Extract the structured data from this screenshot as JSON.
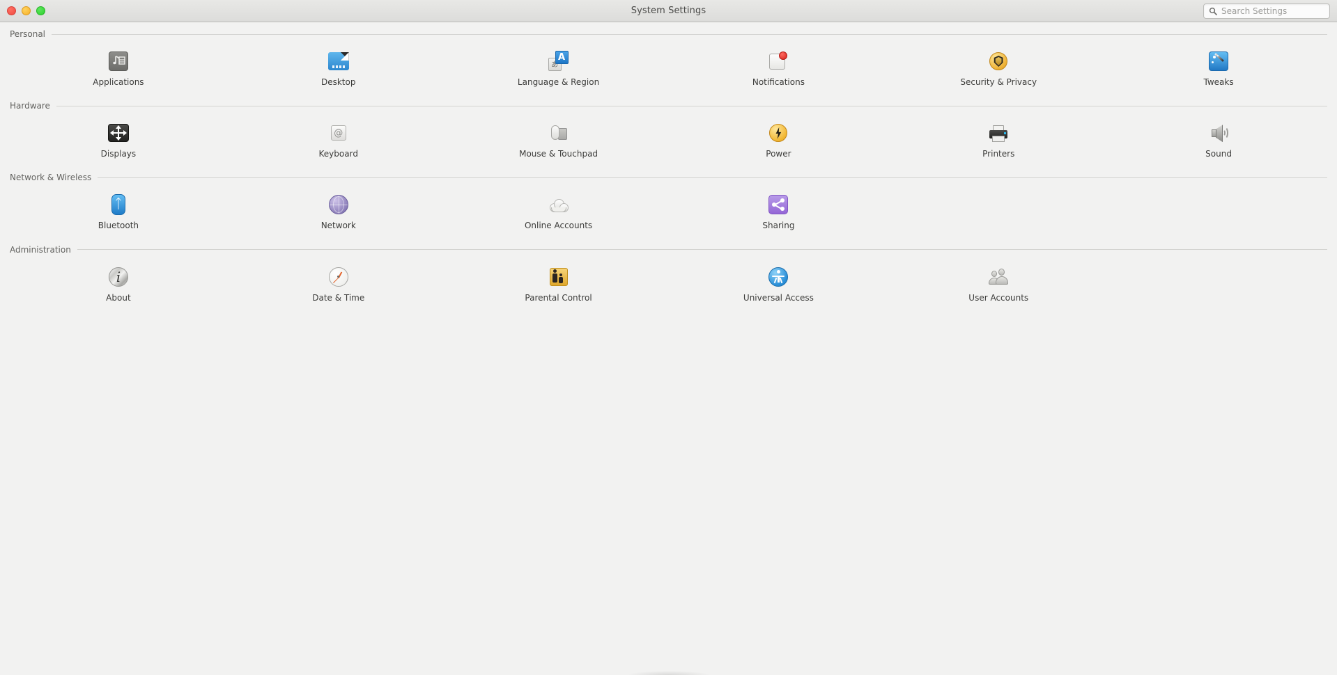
{
  "window": {
    "title": "System Settings",
    "controls": [
      {
        "name": "close",
        "color": "#ef4b42"
      },
      {
        "name": "minimize",
        "color": "#f6b12a"
      },
      {
        "name": "maximize",
        "color": "#2ed02e"
      }
    ]
  },
  "search": {
    "placeholder": "Search Settings",
    "value": "",
    "icon": "search-icon"
  },
  "sections": [
    {
      "id": "personal",
      "title": "Personal",
      "items": [
        {
          "id": "applications",
          "label": "Applications",
          "icon": "applications-icon"
        },
        {
          "id": "desktop",
          "label": "Desktop",
          "icon": "desktop-icon"
        },
        {
          "id": "language-region",
          "label": "Language & Region",
          "icon": "language-region-icon"
        },
        {
          "id": "notifications",
          "label": "Notifications",
          "icon": "notifications-icon"
        },
        {
          "id": "security-privacy",
          "label": "Security & Privacy",
          "icon": "security-privacy-icon"
        },
        {
          "id": "tweaks",
          "label": "Tweaks",
          "icon": "tweaks-icon"
        }
      ]
    },
    {
      "id": "hardware",
      "title": "Hardware",
      "items": [
        {
          "id": "displays",
          "label": "Displays",
          "icon": "displays-icon"
        },
        {
          "id": "keyboard",
          "label": "Keyboard",
          "icon": "keyboard-icon"
        },
        {
          "id": "mouse-touchpad",
          "label": "Mouse & Touchpad",
          "icon": "mouse-touchpad-icon"
        },
        {
          "id": "power",
          "label": "Power",
          "icon": "power-icon"
        },
        {
          "id": "printers",
          "label": "Printers",
          "icon": "printers-icon"
        },
        {
          "id": "sound",
          "label": "Sound",
          "icon": "sound-icon"
        }
      ]
    },
    {
      "id": "network-wireless",
      "title": "Network & Wireless",
      "items": [
        {
          "id": "bluetooth",
          "label": "Bluetooth",
          "icon": "bluetooth-icon"
        },
        {
          "id": "network",
          "label": "Network",
          "icon": "network-icon"
        },
        {
          "id": "online-accounts",
          "label": "Online Accounts",
          "icon": "cloud-icon"
        },
        {
          "id": "sharing",
          "label": "Sharing",
          "icon": "sharing-icon"
        }
      ]
    },
    {
      "id": "administration",
      "title": "Administration",
      "items": [
        {
          "id": "about",
          "label": "About",
          "icon": "info-icon"
        },
        {
          "id": "date-time",
          "label": "Date & Time",
          "icon": "clock-icon"
        },
        {
          "id": "parental-control",
          "label": "Parental Control",
          "icon": "parental-control-icon"
        },
        {
          "id": "universal-access",
          "label": "Universal Access",
          "icon": "universal-access-icon"
        },
        {
          "id": "user-accounts",
          "label": "User Accounts",
          "icon": "users-icon"
        }
      ]
    }
  ],
  "colors": {
    "background": "#f2f2f1",
    "titlebar": "#dedede",
    "section_title": "#62625f",
    "label": "#3c3c3a",
    "rule": "#d3d3d0"
  }
}
